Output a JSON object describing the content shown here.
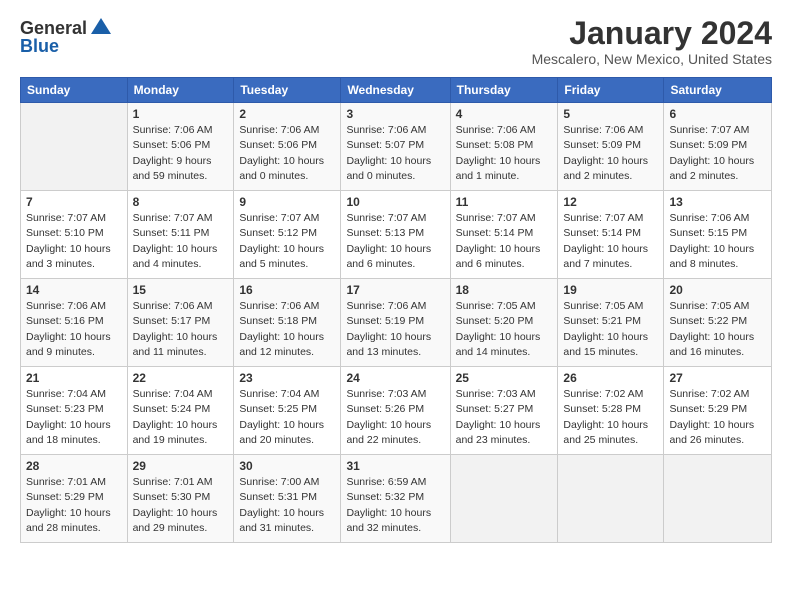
{
  "header": {
    "logo_line1": "General",
    "logo_line2": "Blue",
    "month_title": "January 2024",
    "location": "Mescalero, New Mexico, United States"
  },
  "days_of_week": [
    "Sunday",
    "Monday",
    "Tuesday",
    "Wednesday",
    "Thursday",
    "Friday",
    "Saturday"
  ],
  "weeks": [
    [
      {
        "day": "",
        "sunrise": "",
        "sunset": "",
        "daylight": "",
        "empty": true
      },
      {
        "day": "1",
        "sunrise": "Sunrise: 7:06 AM",
        "sunset": "Sunset: 5:06 PM",
        "daylight": "Daylight: 9 hours and 59 minutes."
      },
      {
        "day": "2",
        "sunrise": "Sunrise: 7:06 AM",
        "sunset": "Sunset: 5:06 PM",
        "daylight": "Daylight: 10 hours and 0 minutes."
      },
      {
        "day": "3",
        "sunrise": "Sunrise: 7:06 AM",
        "sunset": "Sunset: 5:07 PM",
        "daylight": "Daylight: 10 hours and 0 minutes."
      },
      {
        "day": "4",
        "sunrise": "Sunrise: 7:06 AM",
        "sunset": "Sunset: 5:08 PM",
        "daylight": "Daylight: 10 hours and 1 minute."
      },
      {
        "day": "5",
        "sunrise": "Sunrise: 7:06 AM",
        "sunset": "Sunset: 5:09 PM",
        "daylight": "Daylight: 10 hours and 2 minutes."
      },
      {
        "day": "6",
        "sunrise": "Sunrise: 7:07 AM",
        "sunset": "Sunset: 5:09 PM",
        "daylight": "Daylight: 10 hours and 2 minutes."
      }
    ],
    [
      {
        "day": "7",
        "sunrise": "Sunrise: 7:07 AM",
        "sunset": "Sunset: 5:10 PM",
        "daylight": "Daylight: 10 hours and 3 minutes."
      },
      {
        "day": "8",
        "sunrise": "Sunrise: 7:07 AM",
        "sunset": "Sunset: 5:11 PM",
        "daylight": "Daylight: 10 hours and 4 minutes."
      },
      {
        "day": "9",
        "sunrise": "Sunrise: 7:07 AM",
        "sunset": "Sunset: 5:12 PM",
        "daylight": "Daylight: 10 hours and 5 minutes."
      },
      {
        "day": "10",
        "sunrise": "Sunrise: 7:07 AM",
        "sunset": "Sunset: 5:13 PM",
        "daylight": "Daylight: 10 hours and 6 minutes."
      },
      {
        "day": "11",
        "sunrise": "Sunrise: 7:07 AM",
        "sunset": "Sunset: 5:14 PM",
        "daylight": "Daylight: 10 hours and 6 minutes."
      },
      {
        "day": "12",
        "sunrise": "Sunrise: 7:07 AM",
        "sunset": "Sunset: 5:14 PM",
        "daylight": "Daylight: 10 hours and 7 minutes."
      },
      {
        "day": "13",
        "sunrise": "Sunrise: 7:06 AM",
        "sunset": "Sunset: 5:15 PM",
        "daylight": "Daylight: 10 hours and 8 minutes."
      }
    ],
    [
      {
        "day": "14",
        "sunrise": "Sunrise: 7:06 AM",
        "sunset": "Sunset: 5:16 PM",
        "daylight": "Daylight: 10 hours and 9 minutes."
      },
      {
        "day": "15",
        "sunrise": "Sunrise: 7:06 AM",
        "sunset": "Sunset: 5:17 PM",
        "daylight": "Daylight: 10 hours and 11 minutes."
      },
      {
        "day": "16",
        "sunrise": "Sunrise: 7:06 AM",
        "sunset": "Sunset: 5:18 PM",
        "daylight": "Daylight: 10 hours and 12 minutes."
      },
      {
        "day": "17",
        "sunrise": "Sunrise: 7:06 AM",
        "sunset": "Sunset: 5:19 PM",
        "daylight": "Daylight: 10 hours and 13 minutes."
      },
      {
        "day": "18",
        "sunrise": "Sunrise: 7:05 AM",
        "sunset": "Sunset: 5:20 PM",
        "daylight": "Daylight: 10 hours and 14 minutes."
      },
      {
        "day": "19",
        "sunrise": "Sunrise: 7:05 AM",
        "sunset": "Sunset: 5:21 PM",
        "daylight": "Daylight: 10 hours and 15 minutes."
      },
      {
        "day": "20",
        "sunrise": "Sunrise: 7:05 AM",
        "sunset": "Sunset: 5:22 PM",
        "daylight": "Daylight: 10 hours and 16 minutes."
      }
    ],
    [
      {
        "day": "21",
        "sunrise": "Sunrise: 7:04 AM",
        "sunset": "Sunset: 5:23 PM",
        "daylight": "Daylight: 10 hours and 18 minutes."
      },
      {
        "day": "22",
        "sunrise": "Sunrise: 7:04 AM",
        "sunset": "Sunset: 5:24 PM",
        "daylight": "Daylight: 10 hours and 19 minutes."
      },
      {
        "day": "23",
        "sunrise": "Sunrise: 7:04 AM",
        "sunset": "Sunset: 5:25 PM",
        "daylight": "Daylight: 10 hours and 20 minutes."
      },
      {
        "day": "24",
        "sunrise": "Sunrise: 7:03 AM",
        "sunset": "Sunset: 5:26 PM",
        "daylight": "Daylight: 10 hours and 22 minutes."
      },
      {
        "day": "25",
        "sunrise": "Sunrise: 7:03 AM",
        "sunset": "Sunset: 5:27 PM",
        "daylight": "Daylight: 10 hours and 23 minutes."
      },
      {
        "day": "26",
        "sunrise": "Sunrise: 7:02 AM",
        "sunset": "Sunset: 5:28 PM",
        "daylight": "Daylight: 10 hours and 25 minutes."
      },
      {
        "day": "27",
        "sunrise": "Sunrise: 7:02 AM",
        "sunset": "Sunset: 5:29 PM",
        "daylight": "Daylight: 10 hours and 26 minutes."
      }
    ],
    [
      {
        "day": "28",
        "sunrise": "Sunrise: 7:01 AM",
        "sunset": "Sunset: 5:29 PM",
        "daylight": "Daylight: 10 hours and 28 minutes."
      },
      {
        "day": "29",
        "sunrise": "Sunrise: 7:01 AM",
        "sunset": "Sunset: 5:30 PM",
        "daylight": "Daylight: 10 hours and 29 minutes."
      },
      {
        "day": "30",
        "sunrise": "Sunrise: 7:00 AM",
        "sunset": "Sunset: 5:31 PM",
        "daylight": "Daylight: 10 hours and 31 minutes."
      },
      {
        "day": "31",
        "sunrise": "Sunrise: 6:59 AM",
        "sunset": "Sunset: 5:32 PM",
        "daylight": "Daylight: 10 hours and 32 minutes."
      },
      {
        "day": "",
        "sunrise": "",
        "sunset": "",
        "daylight": "",
        "empty": true
      },
      {
        "day": "",
        "sunrise": "",
        "sunset": "",
        "daylight": "",
        "empty": true
      },
      {
        "day": "",
        "sunrise": "",
        "sunset": "",
        "daylight": "",
        "empty": true
      }
    ]
  ]
}
